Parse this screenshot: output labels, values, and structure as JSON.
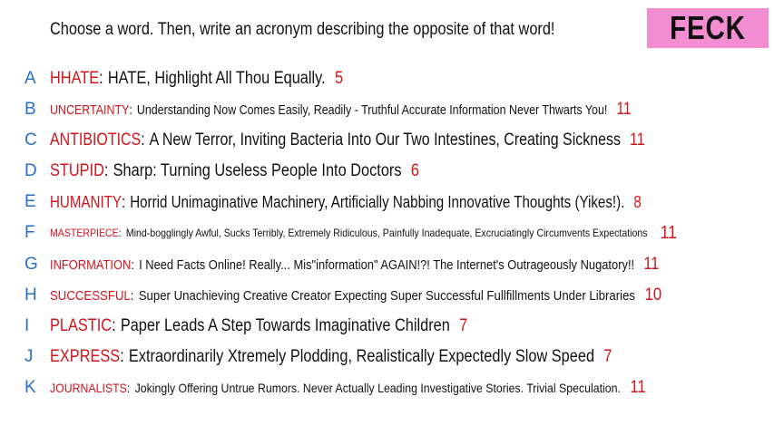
{
  "prompt": "Choose a word. Then, write an acronym describing the opposite of that word!",
  "badge": "FECK",
  "colors": {
    "badge_bg": "#f28dd2",
    "word": "#d0141c",
    "letter": "#2a6fc4"
  },
  "entries": [
    {
      "letter": "A",
      "word": "HHATE",
      "acronym": "HATE, Highlight All Thou Equally.",
      "count": "5"
    },
    {
      "letter": "B",
      "word": "UNCERTAINTY",
      "acronym": "Understanding Now Comes Easily, Readily - Truthful Accurate Information Never Thwarts You!",
      "count": "11"
    },
    {
      "letter": "C",
      "word": "ANTIBIOTICS",
      "acronym": "A New Terror, Inviting Bacteria Into Our Two Intestines, Creating Sickness",
      "count": "11"
    },
    {
      "letter": "D",
      "word": "STUPID",
      "acronym": "Sharp: Turning Useless People Into Doctors",
      "count": "6"
    },
    {
      "letter": "E",
      "word": "HUMANITY",
      "acronym": "Horrid Unimaginative Machinery, Artificially Nabbing Innovative Thoughts (Yikes!).",
      "count": "8"
    },
    {
      "letter": "F",
      "word": "MASTERPIECE",
      "acronym": "Mind-bogglingly Awful, Sucks Terribly, Extremely Ridiculous, Painfully Inadequate, Excruciatingly Circumvents Expectations",
      "count": "11"
    },
    {
      "letter": "G",
      "word": "INFORMATION",
      "acronym": "I Need Facts Online! Really... Mis\"information\" AGAIN!?! The Internet's Outrageously Nugatory!!",
      "count": "11"
    },
    {
      "letter": "H",
      "word": "SUCCESSFUL",
      "acronym": "Super Unachieving Creative Creator Expecting Super Successful Fullfillments Under Libraries",
      "count": "10"
    },
    {
      "letter": "I",
      "word": "PLASTIC",
      "acronym": "Paper Leads A Step Towards Imaginative Children",
      "count": "7"
    },
    {
      "letter": "J",
      "word": "EXPRESS",
      "acronym": "Extraordinarily Xtremely Plodding, Realistically Expectedly Slow Speed",
      "count": "7"
    },
    {
      "letter": "K",
      "word": "JOURNALISTS",
      "acronym": "Jokingly Offering Untrue Rumors. Never Actually Leading Investigative Stories. Trivial Speculation.",
      "count": "11"
    }
  ]
}
